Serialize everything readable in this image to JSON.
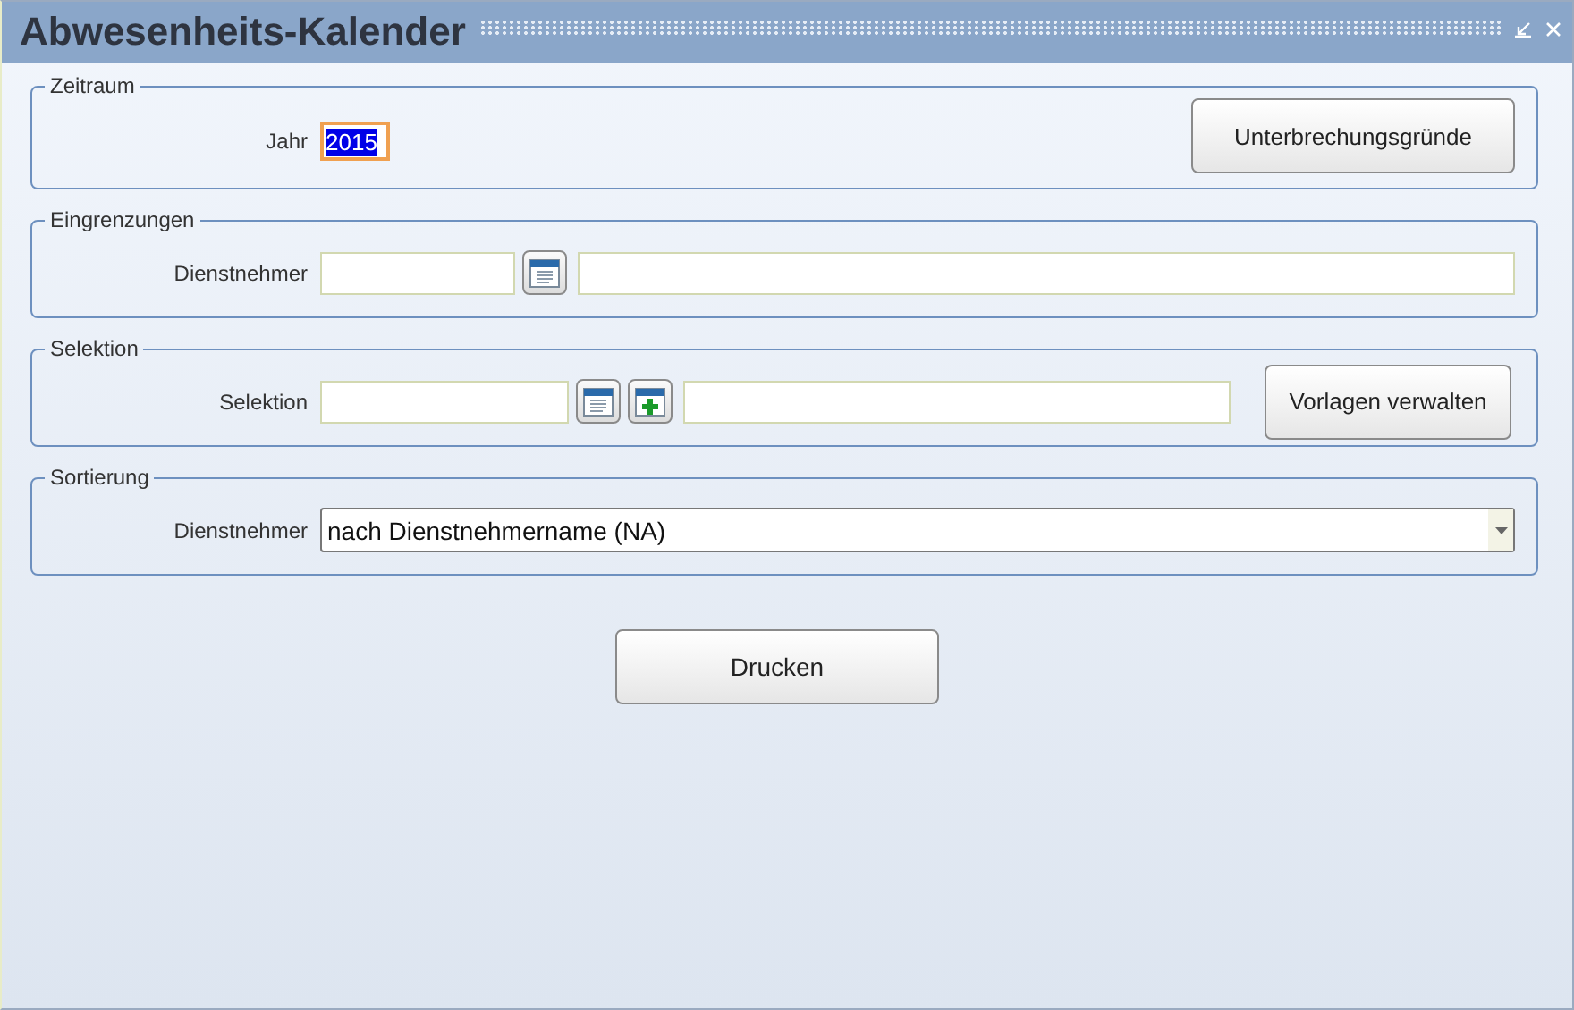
{
  "window": {
    "title": "Abwesenheits-Kalender"
  },
  "groups": [
    {
      "kind": "year",
      "legend": "Zeitraum",
      "label": "Jahr",
      "value": "2015",
      "highlighted": true,
      "button": "Unterbrechungsgründe"
    },
    {
      "kind": "lookup",
      "legend": "Eingrenzungen",
      "label": "Dienstnehmer"
    },
    {
      "kind": "selection",
      "legend": "Selektion",
      "label": "Selektion",
      "button": "Vorlagen verwalten"
    },
    {
      "kind": "dropdown",
      "legend": "Sortierung",
      "label": "Dienstnehmer",
      "value": "nach Dienstnehmername (NA)"
    }
  ],
  "print_button": "Drucken"
}
